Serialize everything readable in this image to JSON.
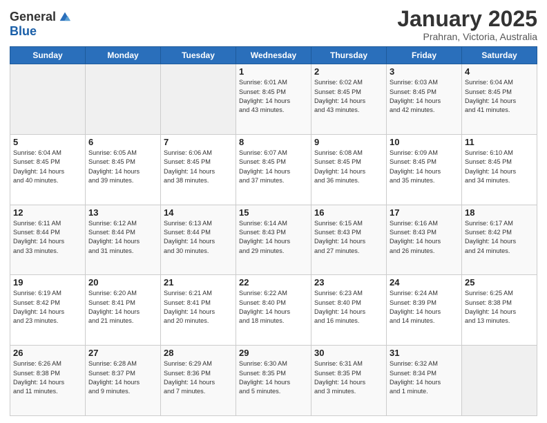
{
  "header": {
    "logo_general": "General",
    "logo_blue": "Blue",
    "month_title": "January 2025",
    "location": "Prahran, Victoria, Australia"
  },
  "days_of_week": [
    "Sunday",
    "Monday",
    "Tuesday",
    "Wednesday",
    "Thursday",
    "Friday",
    "Saturday"
  ],
  "weeks": [
    [
      {
        "day": "",
        "info": ""
      },
      {
        "day": "",
        "info": ""
      },
      {
        "day": "",
        "info": ""
      },
      {
        "day": "1",
        "info": "Sunrise: 6:01 AM\nSunset: 8:45 PM\nDaylight: 14 hours\nand 43 minutes."
      },
      {
        "day": "2",
        "info": "Sunrise: 6:02 AM\nSunset: 8:45 PM\nDaylight: 14 hours\nand 43 minutes."
      },
      {
        "day": "3",
        "info": "Sunrise: 6:03 AM\nSunset: 8:45 PM\nDaylight: 14 hours\nand 42 minutes."
      },
      {
        "day": "4",
        "info": "Sunrise: 6:04 AM\nSunset: 8:45 PM\nDaylight: 14 hours\nand 41 minutes."
      }
    ],
    [
      {
        "day": "5",
        "info": "Sunrise: 6:04 AM\nSunset: 8:45 PM\nDaylight: 14 hours\nand 40 minutes."
      },
      {
        "day": "6",
        "info": "Sunrise: 6:05 AM\nSunset: 8:45 PM\nDaylight: 14 hours\nand 39 minutes."
      },
      {
        "day": "7",
        "info": "Sunrise: 6:06 AM\nSunset: 8:45 PM\nDaylight: 14 hours\nand 38 minutes."
      },
      {
        "day": "8",
        "info": "Sunrise: 6:07 AM\nSunset: 8:45 PM\nDaylight: 14 hours\nand 37 minutes."
      },
      {
        "day": "9",
        "info": "Sunrise: 6:08 AM\nSunset: 8:45 PM\nDaylight: 14 hours\nand 36 minutes."
      },
      {
        "day": "10",
        "info": "Sunrise: 6:09 AM\nSunset: 8:45 PM\nDaylight: 14 hours\nand 35 minutes."
      },
      {
        "day": "11",
        "info": "Sunrise: 6:10 AM\nSunset: 8:45 PM\nDaylight: 14 hours\nand 34 minutes."
      }
    ],
    [
      {
        "day": "12",
        "info": "Sunrise: 6:11 AM\nSunset: 8:44 PM\nDaylight: 14 hours\nand 33 minutes."
      },
      {
        "day": "13",
        "info": "Sunrise: 6:12 AM\nSunset: 8:44 PM\nDaylight: 14 hours\nand 31 minutes."
      },
      {
        "day": "14",
        "info": "Sunrise: 6:13 AM\nSunset: 8:44 PM\nDaylight: 14 hours\nand 30 minutes."
      },
      {
        "day": "15",
        "info": "Sunrise: 6:14 AM\nSunset: 8:43 PM\nDaylight: 14 hours\nand 29 minutes."
      },
      {
        "day": "16",
        "info": "Sunrise: 6:15 AM\nSunset: 8:43 PM\nDaylight: 14 hours\nand 27 minutes."
      },
      {
        "day": "17",
        "info": "Sunrise: 6:16 AM\nSunset: 8:43 PM\nDaylight: 14 hours\nand 26 minutes."
      },
      {
        "day": "18",
        "info": "Sunrise: 6:17 AM\nSunset: 8:42 PM\nDaylight: 14 hours\nand 24 minutes."
      }
    ],
    [
      {
        "day": "19",
        "info": "Sunrise: 6:19 AM\nSunset: 8:42 PM\nDaylight: 14 hours\nand 23 minutes."
      },
      {
        "day": "20",
        "info": "Sunrise: 6:20 AM\nSunset: 8:41 PM\nDaylight: 14 hours\nand 21 minutes."
      },
      {
        "day": "21",
        "info": "Sunrise: 6:21 AM\nSunset: 8:41 PM\nDaylight: 14 hours\nand 20 minutes."
      },
      {
        "day": "22",
        "info": "Sunrise: 6:22 AM\nSunset: 8:40 PM\nDaylight: 14 hours\nand 18 minutes."
      },
      {
        "day": "23",
        "info": "Sunrise: 6:23 AM\nSunset: 8:40 PM\nDaylight: 14 hours\nand 16 minutes."
      },
      {
        "day": "24",
        "info": "Sunrise: 6:24 AM\nSunset: 8:39 PM\nDaylight: 14 hours\nand 14 minutes."
      },
      {
        "day": "25",
        "info": "Sunrise: 6:25 AM\nSunset: 8:38 PM\nDaylight: 14 hours\nand 13 minutes."
      }
    ],
    [
      {
        "day": "26",
        "info": "Sunrise: 6:26 AM\nSunset: 8:38 PM\nDaylight: 14 hours\nand 11 minutes."
      },
      {
        "day": "27",
        "info": "Sunrise: 6:28 AM\nSunset: 8:37 PM\nDaylight: 14 hours\nand 9 minutes."
      },
      {
        "day": "28",
        "info": "Sunrise: 6:29 AM\nSunset: 8:36 PM\nDaylight: 14 hours\nand 7 minutes."
      },
      {
        "day": "29",
        "info": "Sunrise: 6:30 AM\nSunset: 8:35 PM\nDaylight: 14 hours\nand 5 minutes."
      },
      {
        "day": "30",
        "info": "Sunrise: 6:31 AM\nSunset: 8:35 PM\nDaylight: 14 hours\nand 3 minutes."
      },
      {
        "day": "31",
        "info": "Sunrise: 6:32 AM\nSunset: 8:34 PM\nDaylight: 14 hours\nand 1 minute."
      },
      {
        "day": "",
        "info": ""
      }
    ]
  ]
}
